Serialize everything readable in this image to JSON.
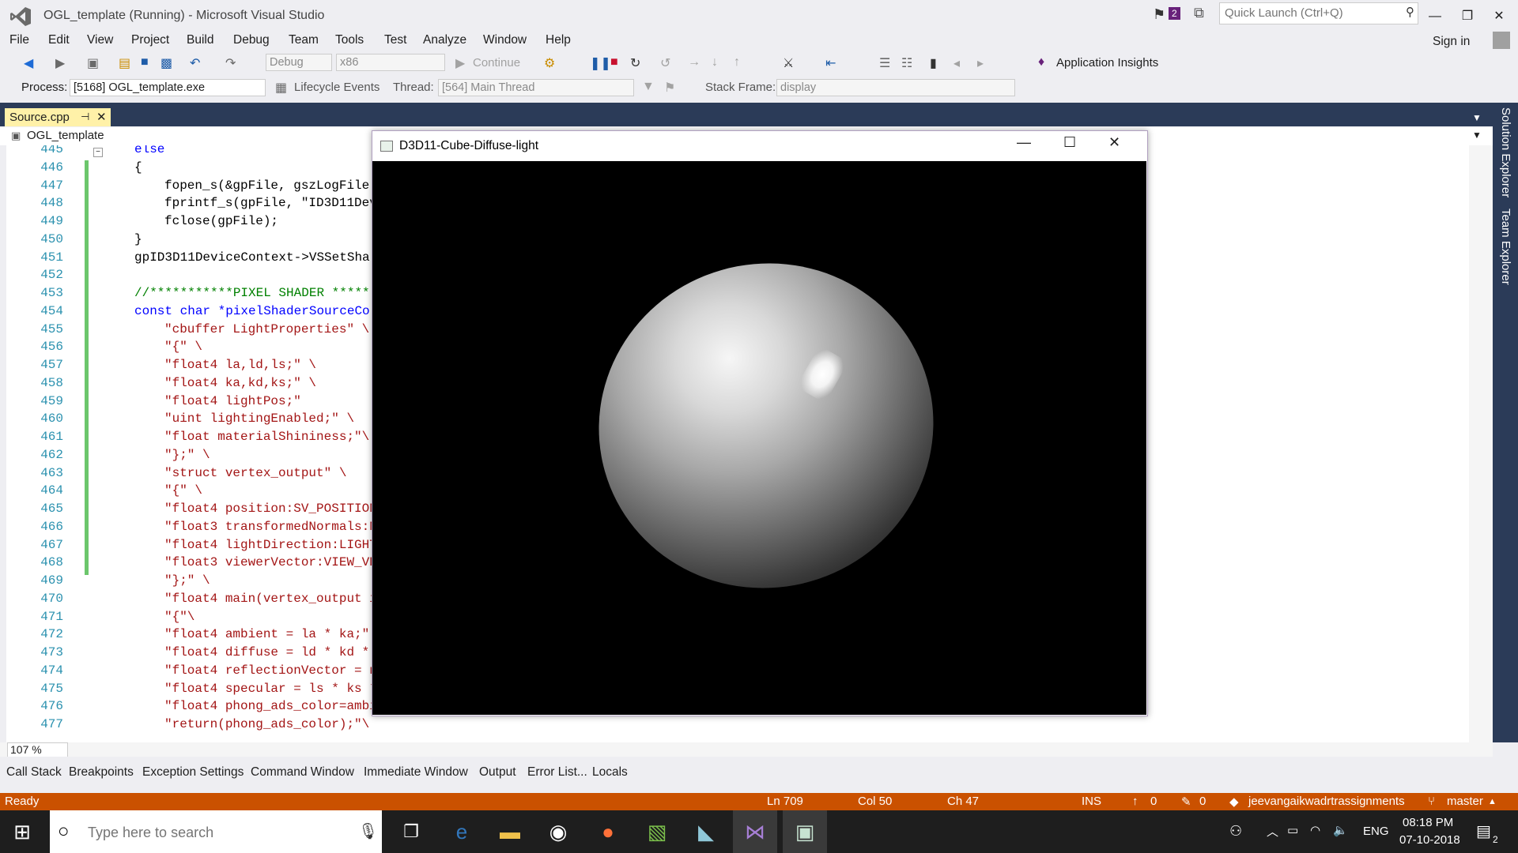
{
  "window": {
    "title": "OGL_template (Running) - Microsoft Visual Studio",
    "notifications_count": "2",
    "quick_launch_placeholder": "Quick Launch (Ctrl+Q)",
    "sign_in": "Sign in"
  },
  "menu": [
    "File",
    "Edit",
    "View",
    "Project",
    "Build",
    "Debug",
    "Team",
    "Tools",
    "Test",
    "Analyze",
    "Window",
    "Help"
  ],
  "toolbar": {
    "config": "Debug",
    "platform": "x86",
    "continue_label": "Continue",
    "app_insights": "Application Insights"
  },
  "debug_location": {
    "process_label": "Process:",
    "process_value": "[5168] OGL_template.exe",
    "lifecycle_label": "Lifecycle Events",
    "thread_label": "Thread:",
    "thread_value": "[564] Main Thread",
    "stack_frame_label": "Stack Frame:",
    "stack_frame_value": "display"
  },
  "editor": {
    "tab_name": "Source.cpp",
    "nav_scope": "OGL_template",
    "zoom": "107 %",
    "lines": [
      {
        "n": "445",
        "t": "else",
        "cls": "kw",
        "indent": 0
      },
      {
        "n": "446",
        "t": "{",
        "cls": "",
        "indent": 0
      },
      {
        "n": "447",
        "t": "fopen_s(&gpFile, gszLogFile",
        "cls": "",
        "indent": 1
      },
      {
        "n": "448",
        "t": "fprintf_s(gpFile, \"ID3D11Dev",
        "cls": "mix",
        "indent": 1
      },
      {
        "n": "449",
        "t": "fclose(gpFile);",
        "cls": "",
        "indent": 1
      },
      {
        "n": "450",
        "t": "}",
        "cls": "",
        "indent": 0
      },
      {
        "n": "451",
        "t": "gpID3D11DeviceContext->VSSetSha",
        "cls": "",
        "indent": 0
      },
      {
        "n": "452",
        "t": "",
        "cls": "",
        "indent": 0
      },
      {
        "n": "453",
        "t": "//***********PIXEL SHADER *****",
        "cls": "cm",
        "indent": 0
      },
      {
        "n": "454",
        "t": "const char *pixelShaderSourceCo",
        "cls": "kw",
        "indent": 0
      },
      {
        "n": "455",
        "t": "\"cbuffer LightProperties\" \\",
        "cls": "str",
        "indent": 1
      },
      {
        "n": "456",
        "t": "\"{\" \\",
        "cls": "str",
        "indent": 1
      },
      {
        "n": "457",
        "t": "\"float4 la,ld,ls;\" \\",
        "cls": "str",
        "indent": 1
      },
      {
        "n": "458",
        "t": "\"float4 ka,kd,ks;\" \\",
        "cls": "str",
        "indent": 1
      },
      {
        "n": "459",
        "t": "\"float4 lightPos;\"",
        "cls": "str",
        "indent": 1
      },
      {
        "n": "460",
        "t": "\"uint lightingEnabled;\" \\",
        "cls": "str",
        "indent": 1
      },
      {
        "n": "461",
        "t": "\"float materialShininess;\"\\",
        "cls": "str",
        "indent": 1
      },
      {
        "n": "462",
        "t": "\"};\" \\",
        "cls": "str",
        "indent": 1
      },
      {
        "n": "463",
        "t": "\"struct vertex_output\" \\",
        "cls": "str",
        "indent": 1
      },
      {
        "n": "464",
        "t": "\"{\" \\",
        "cls": "str",
        "indent": 1
      },
      {
        "n": "465",
        "t": "\"float4 position:SV_POSITION",
        "cls": "str",
        "indent": 1
      },
      {
        "n": "466",
        "t": "\"float3 transformedNormals:N",
        "cls": "str",
        "indent": 1
      },
      {
        "n": "467",
        "t": "\"float4 lightDirection:LIGHT",
        "cls": "str",
        "indent": 1
      },
      {
        "n": "468",
        "t": "\"float3 viewerVector:VIEW_VE",
        "cls": "str",
        "indent": 1
      },
      {
        "n": "469",
        "t": "\"};\" \\",
        "cls": "str",
        "indent": 1
      },
      {
        "n": "470",
        "t": "\"float4 main(vertex_output i",
        "cls": "str",
        "indent": 1
      },
      {
        "n": "471",
        "t": "\"{\"\\",
        "cls": "str",
        "indent": 1
      },
      {
        "n": "472",
        "t": "\"float4 ambient = la * ka;\"",
        "cls": "str",
        "indent": 1
      },
      {
        "n": "473",
        "t": "\"float4 diffuse = ld * kd *",
        "cls": "str",
        "indent": 1
      },
      {
        "n": "474",
        "t": "\"float4 reflectionVector = n",
        "cls": "str",
        "indent": 1
      },
      {
        "n": "475",
        "t": "\"float4 specular = ls * ks *",
        "cls": "str",
        "indent": 1
      },
      {
        "n": "476",
        "t": "\"float4 phong_ads_color=ambi",
        "cls": "str",
        "indent": 1
      },
      {
        "n": "477",
        "t": "\"return(phong_ads_color);\"\\",
        "cls": "str",
        "indent": 1
      }
    ]
  },
  "d3d_window": {
    "title": "D3D11-Cube-Diffuse-light"
  },
  "side_tabs": [
    "Solution Explorer",
    "Team Explorer"
  ],
  "bottom_tabs": [
    "Call Stack",
    "Breakpoints",
    "Exception Settings",
    "Command Window",
    "Immediate Window",
    "Output",
    "Error List...",
    "Locals"
  ],
  "status": {
    "state": "Ready",
    "ln": "Ln 709",
    "col": "Col 50",
    "ch": "Ch 47",
    "ins": "INS",
    "up_count": "0",
    "pencil_count": "0",
    "repo": "jeevangaikwadrtrassignments",
    "branch": "master"
  },
  "taskbar": {
    "search_placeholder": "Type here to search",
    "lang": "ENG",
    "time": "08:18 PM",
    "date": "07-10-2018",
    "notification_count": "2"
  },
  "colors": {
    "status_bar": "#ca5100",
    "tab_strip": "#2b3b58",
    "active_tab": "#fff1a8",
    "vs_purple": "#68217a"
  }
}
